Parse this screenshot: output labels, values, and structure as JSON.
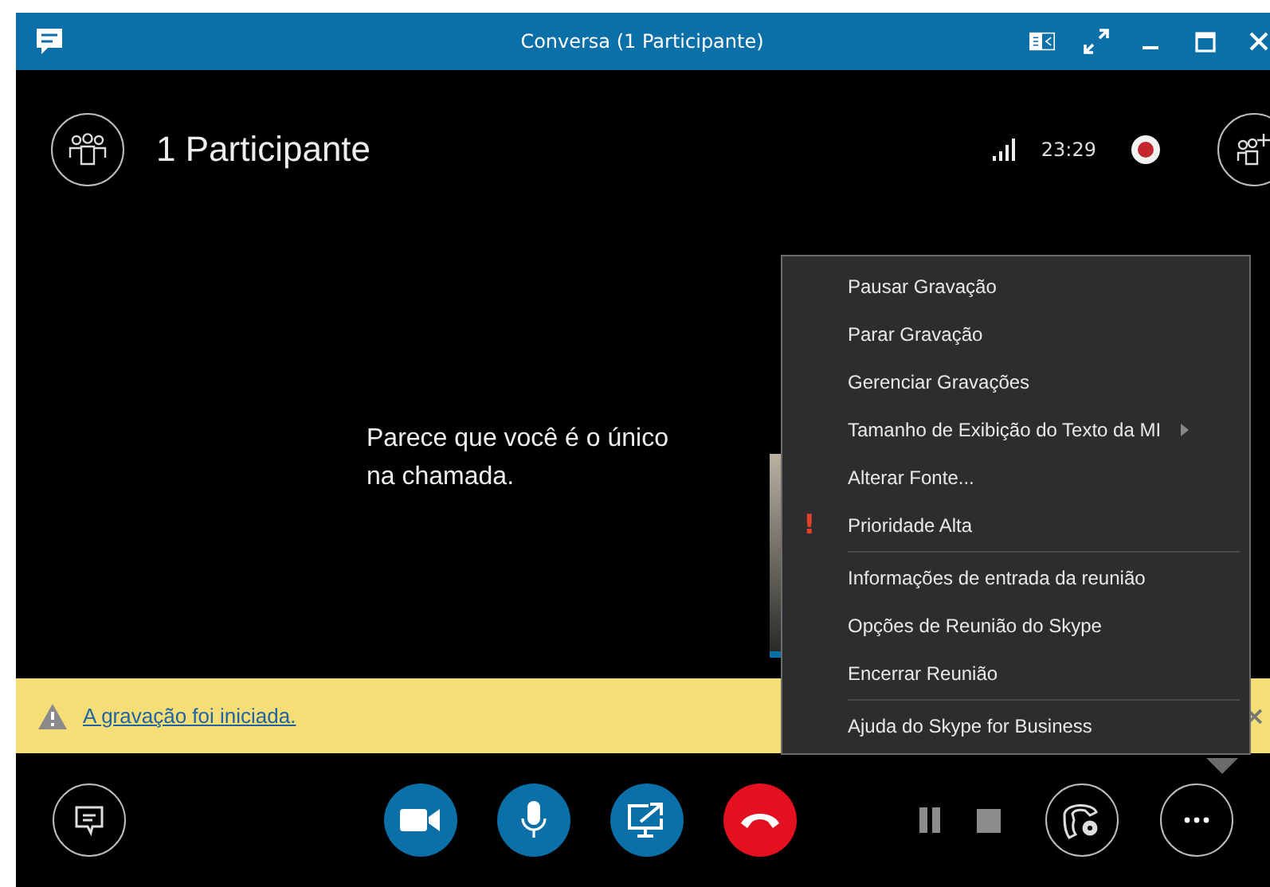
{
  "window": {
    "title": "Conversa (1 Participante)"
  },
  "header": {
    "title": "1 Participante",
    "time": "23:29",
    "recording": true
  },
  "stage": {
    "message": "Parece que você é o único na chamada."
  },
  "banner": {
    "link": "A gravação foi iniciada.",
    "close": "×"
  },
  "menu": {
    "groups": [
      [
        {
          "label": "Pausar Gravação",
          "submenu": false
        },
        {
          "label": "Parar Gravação",
          "submenu": false
        },
        {
          "label": "Gerenciar Gravações",
          "submenu": false
        },
        {
          "label": "Tamanho de Exibição do Texto da MI",
          "submenu": true
        },
        {
          "label": "Alterar Fonte...",
          "submenu": false
        },
        {
          "label": "Prioridade Alta",
          "submenu": false,
          "flag": "!"
        }
      ],
      [
        {
          "label": "Informações de entrada da reunião",
          "submenu": false
        },
        {
          "label": "Opções de Reunião do Skype",
          "submenu": false
        },
        {
          "label": "Encerrar Reunião",
          "submenu": false
        }
      ],
      [
        {
          "label": "Ajuda do Skype for Business",
          "submenu": false
        }
      ]
    ]
  },
  "controls": [
    {
      "kind": "video"
    },
    {
      "kind": "mic"
    },
    {
      "kind": "share"
    },
    {
      "kind": "hangup"
    }
  ]
}
